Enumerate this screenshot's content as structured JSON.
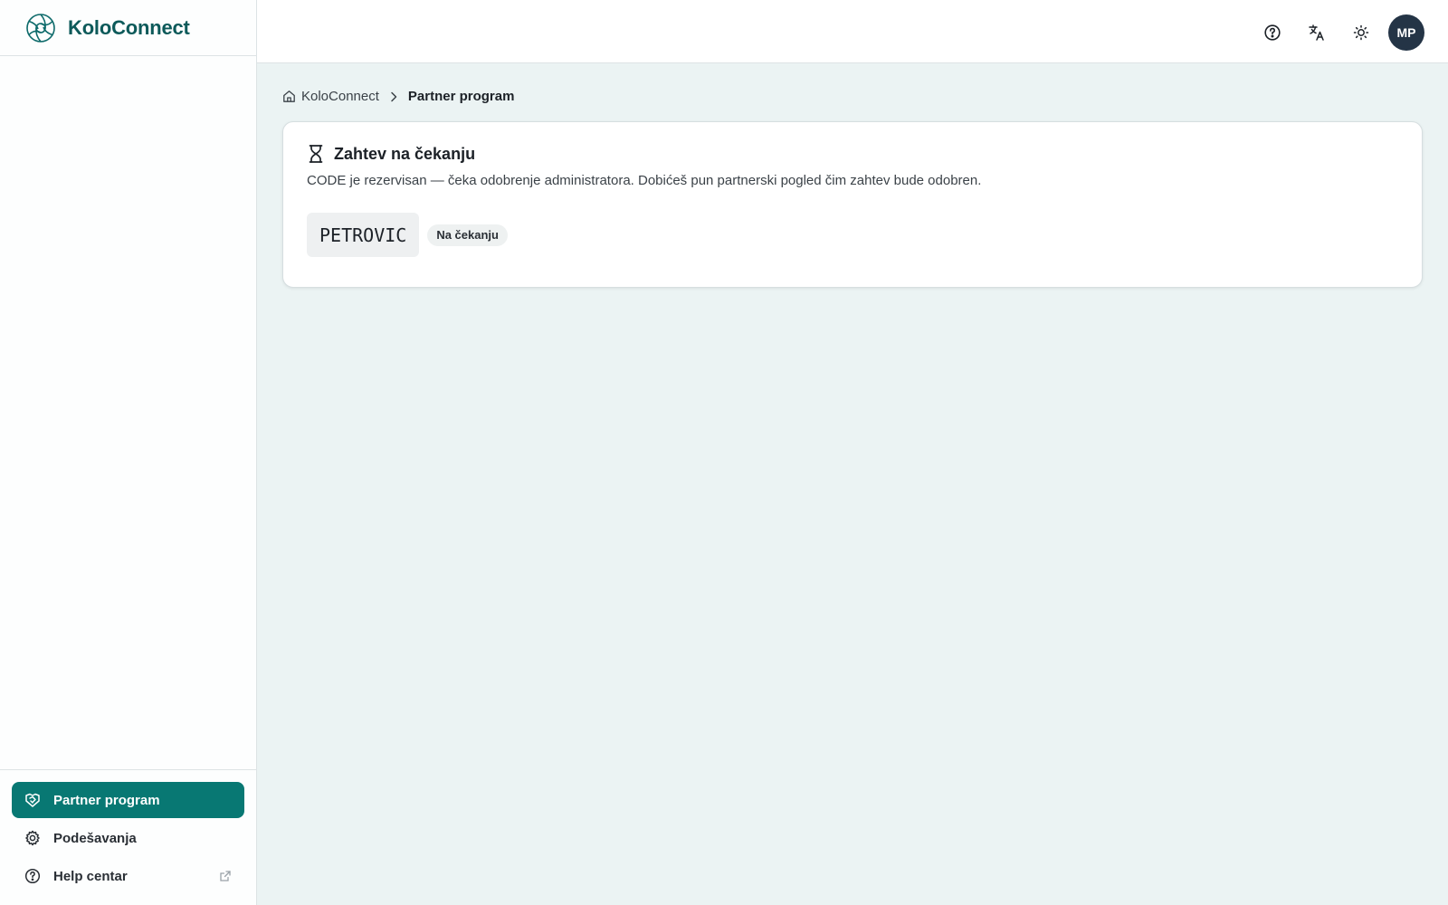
{
  "app": {
    "name": "KoloConnect"
  },
  "sidebar": {
    "items": [
      {
        "label": "Partner program",
        "icon": "handshake-icon",
        "active": true
      },
      {
        "label": "Podešavanja",
        "icon": "gear-icon",
        "active": false
      },
      {
        "label": "Help centar",
        "icon": "help-circle-icon",
        "active": false,
        "external": true
      }
    ]
  },
  "topbar": {
    "actions": [
      "help-icon",
      "translate-icon",
      "sun-icon"
    ],
    "avatar_initials": "MP"
  },
  "breadcrumb": {
    "home": "KoloConnect",
    "current": "Partner program"
  },
  "card": {
    "title": "Zahtev na čekanju",
    "description": "CODE je rezervisan — čeka odobrenje administratora. Dobićeš pun partnerski pogled čim zahtev bude odobren.",
    "code": "PETROVIC",
    "status": "Na čekanju"
  },
  "colors": {
    "accent": "#087873",
    "brand_text": "#0d5a5a",
    "background": "#ebf3f3",
    "avatar": "#243446"
  }
}
